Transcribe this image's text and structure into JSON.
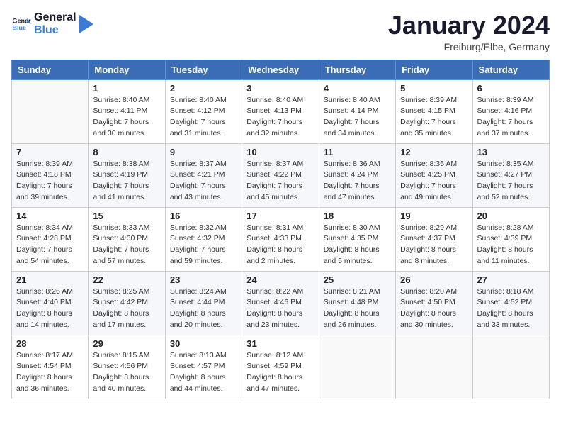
{
  "header": {
    "logo_line1": "General",
    "logo_line2": "Blue",
    "month": "January 2024",
    "location": "Freiburg/Elbe, Germany"
  },
  "weekdays": [
    "Sunday",
    "Monday",
    "Tuesday",
    "Wednesday",
    "Thursday",
    "Friday",
    "Saturday"
  ],
  "weeks": [
    [
      {
        "day": "",
        "sunrise": "",
        "sunset": "",
        "daylight": ""
      },
      {
        "day": "1",
        "sunrise": "Sunrise: 8:40 AM",
        "sunset": "Sunset: 4:11 PM",
        "daylight": "Daylight: 7 hours and 30 minutes."
      },
      {
        "day": "2",
        "sunrise": "Sunrise: 8:40 AM",
        "sunset": "Sunset: 4:12 PM",
        "daylight": "Daylight: 7 hours and 31 minutes."
      },
      {
        "day": "3",
        "sunrise": "Sunrise: 8:40 AM",
        "sunset": "Sunset: 4:13 PM",
        "daylight": "Daylight: 7 hours and 32 minutes."
      },
      {
        "day": "4",
        "sunrise": "Sunrise: 8:40 AM",
        "sunset": "Sunset: 4:14 PM",
        "daylight": "Daylight: 7 hours and 34 minutes."
      },
      {
        "day": "5",
        "sunrise": "Sunrise: 8:39 AM",
        "sunset": "Sunset: 4:15 PM",
        "daylight": "Daylight: 7 hours and 35 minutes."
      },
      {
        "day": "6",
        "sunrise": "Sunrise: 8:39 AM",
        "sunset": "Sunset: 4:16 PM",
        "daylight": "Daylight: 7 hours and 37 minutes."
      }
    ],
    [
      {
        "day": "7",
        "sunrise": "Sunrise: 8:39 AM",
        "sunset": "Sunset: 4:18 PM",
        "daylight": "Daylight: 7 hours and 39 minutes."
      },
      {
        "day": "8",
        "sunrise": "Sunrise: 8:38 AM",
        "sunset": "Sunset: 4:19 PM",
        "daylight": "Daylight: 7 hours and 41 minutes."
      },
      {
        "day": "9",
        "sunrise": "Sunrise: 8:37 AM",
        "sunset": "Sunset: 4:21 PM",
        "daylight": "Daylight: 7 hours and 43 minutes."
      },
      {
        "day": "10",
        "sunrise": "Sunrise: 8:37 AM",
        "sunset": "Sunset: 4:22 PM",
        "daylight": "Daylight: 7 hours and 45 minutes."
      },
      {
        "day": "11",
        "sunrise": "Sunrise: 8:36 AM",
        "sunset": "Sunset: 4:24 PM",
        "daylight": "Daylight: 7 hours and 47 minutes."
      },
      {
        "day": "12",
        "sunrise": "Sunrise: 8:35 AM",
        "sunset": "Sunset: 4:25 PM",
        "daylight": "Daylight: 7 hours and 49 minutes."
      },
      {
        "day": "13",
        "sunrise": "Sunrise: 8:35 AM",
        "sunset": "Sunset: 4:27 PM",
        "daylight": "Daylight: 7 hours and 52 minutes."
      }
    ],
    [
      {
        "day": "14",
        "sunrise": "Sunrise: 8:34 AM",
        "sunset": "Sunset: 4:28 PM",
        "daylight": "Daylight: 7 hours and 54 minutes."
      },
      {
        "day": "15",
        "sunrise": "Sunrise: 8:33 AM",
        "sunset": "Sunset: 4:30 PM",
        "daylight": "Daylight: 7 hours and 57 minutes."
      },
      {
        "day": "16",
        "sunrise": "Sunrise: 8:32 AM",
        "sunset": "Sunset: 4:32 PM",
        "daylight": "Daylight: 7 hours and 59 minutes."
      },
      {
        "day": "17",
        "sunrise": "Sunrise: 8:31 AM",
        "sunset": "Sunset: 4:33 PM",
        "daylight": "Daylight: 8 hours and 2 minutes."
      },
      {
        "day": "18",
        "sunrise": "Sunrise: 8:30 AM",
        "sunset": "Sunset: 4:35 PM",
        "daylight": "Daylight: 8 hours and 5 minutes."
      },
      {
        "day": "19",
        "sunrise": "Sunrise: 8:29 AM",
        "sunset": "Sunset: 4:37 PM",
        "daylight": "Daylight: 8 hours and 8 minutes."
      },
      {
        "day": "20",
        "sunrise": "Sunrise: 8:28 AM",
        "sunset": "Sunset: 4:39 PM",
        "daylight": "Daylight: 8 hours and 11 minutes."
      }
    ],
    [
      {
        "day": "21",
        "sunrise": "Sunrise: 8:26 AM",
        "sunset": "Sunset: 4:40 PM",
        "daylight": "Daylight: 8 hours and 14 minutes."
      },
      {
        "day": "22",
        "sunrise": "Sunrise: 8:25 AM",
        "sunset": "Sunset: 4:42 PM",
        "daylight": "Daylight: 8 hours and 17 minutes."
      },
      {
        "day": "23",
        "sunrise": "Sunrise: 8:24 AM",
        "sunset": "Sunset: 4:44 PM",
        "daylight": "Daylight: 8 hours and 20 minutes."
      },
      {
        "day": "24",
        "sunrise": "Sunrise: 8:22 AM",
        "sunset": "Sunset: 4:46 PM",
        "daylight": "Daylight: 8 hours and 23 minutes."
      },
      {
        "day": "25",
        "sunrise": "Sunrise: 8:21 AM",
        "sunset": "Sunset: 4:48 PM",
        "daylight": "Daylight: 8 hours and 26 minutes."
      },
      {
        "day": "26",
        "sunrise": "Sunrise: 8:20 AM",
        "sunset": "Sunset: 4:50 PM",
        "daylight": "Daylight: 8 hours and 30 minutes."
      },
      {
        "day": "27",
        "sunrise": "Sunrise: 8:18 AM",
        "sunset": "Sunset: 4:52 PM",
        "daylight": "Daylight: 8 hours and 33 minutes."
      }
    ],
    [
      {
        "day": "28",
        "sunrise": "Sunrise: 8:17 AM",
        "sunset": "Sunset: 4:54 PM",
        "daylight": "Daylight: 8 hours and 36 minutes."
      },
      {
        "day": "29",
        "sunrise": "Sunrise: 8:15 AM",
        "sunset": "Sunset: 4:56 PM",
        "daylight": "Daylight: 8 hours and 40 minutes."
      },
      {
        "day": "30",
        "sunrise": "Sunrise: 8:13 AM",
        "sunset": "Sunset: 4:57 PM",
        "daylight": "Daylight: 8 hours and 44 minutes."
      },
      {
        "day": "31",
        "sunrise": "Sunrise: 8:12 AM",
        "sunset": "Sunset: 4:59 PM",
        "daylight": "Daylight: 8 hours and 47 minutes."
      },
      {
        "day": "",
        "sunrise": "",
        "sunset": "",
        "daylight": ""
      },
      {
        "day": "",
        "sunrise": "",
        "sunset": "",
        "daylight": ""
      },
      {
        "day": "",
        "sunrise": "",
        "sunset": "",
        "daylight": ""
      }
    ]
  ]
}
